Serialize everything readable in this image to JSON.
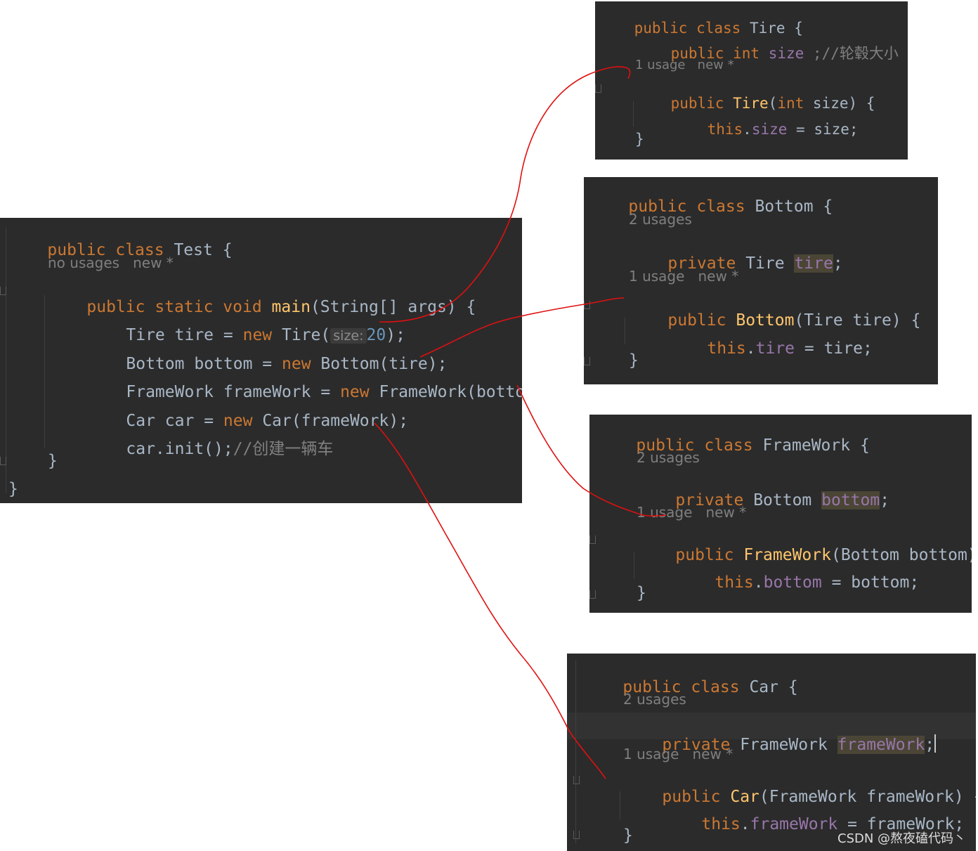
{
  "test": {
    "l1": {
      "kw1": "public",
      "kw2": "class",
      "name": "Test",
      "brace": "{"
    },
    "hint": "no usages   new *",
    "l2": {
      "kw1": "public",
      "kw2": "static",
      "kw3": "void",
      "method": "main",
      "rest": "(String[] args) {"
    },
    "l3": {
      "type": "Tire",
      "var": "tire",
      "eq": "=",
      "kw": "new",
      "ctor": "Tire(",
      "param_hint": "size:",
      "num": "20",
      "end": ");"
    },
    "l4": {
      "type": "Bottom",
      "var": "bottom",
      "eq": "=",
      "kw": "new",
      "rest": "Bottom(tire);"
    },
    "l5": {
      "type": "FrameWork",
      "var": "frameWork",
      "eq": "=",
      "kw": "new",
      "rest": "FrameWork(bottom);"
    },
    "l6": {
      "type": "Car",
      "var": "car",
      "eq": "=",
      "kw": "new",
      "rest": "Car(frameWork);"
    },
    "l7": {
      "code": "car.init();",
      "comment": "//创建一辆车"
    },
    "close_inner": "}",
    "close_outer": "}"
  },
  "tire": {
    "l1": {
      "kw1": "public",
      "kw2": "class",
      "name": "Tire",
      "brace": "{"
    },
    "l2": {
      "kw1": "public",
      "kw2": "int",
      "field": "size",
      "comment": ";//轮毂大小"
    },
    "hint": "1 usage   new *",
    "l3": {
      "kw": "public",
      "ctor": "Tire",
      "p1": "(",
      "ptype": "int",
      "rest": " size) {"
    },
    "l4": {
      "kw": "this",
      "dot": ".",
      "field": "size",
      "rest": " = size;"
    },
    "close": "}"
  },
  "bottom": {
    "l1": {
      "kw1": "public",
      "kw2": "class",
      "name": "Bottom",
      "brace": "{"
    },
    "hint1": "2 usages",
    "l2": {
      "kw": "private",
      "type": "Tire",
      "field": "tire",
      "semi": ";"
    },
    "hint2": "1 usage   new *",
    "l3": {
      "kw": "public",
      "ctor": "Bottom",
      "rest": "(Tire tire) {"
    },
    "l4": {
      "kw": "this",
      "dot": ".",
      "field": "tire",
      "rest": " = tire;"
    },
    "close": "}"
  },
  "framework": {
    "l1": {
      "kw1": "public",
      "kw2": "class",
      "name": "FrameWork",
      "brace": "{"
    },
    "hint1": "2 usages",
    "l2": {
      "kw": "private",
      "type": "Bottom",
      "field": "bottom",
      "semi": ";"
    },
    "hint2": "1 usage   new *",
    "l3": {
      "kw": "public",
      "ctor": "FrameWork",
      "rest": "(Bottom bottom) {"
    },
    "l4": {
      "kw": "this",
      "dot": ".",
      "field": "bottom",
      "rest": " = bottom;"
    },
    "close": "}"
  },
  "car": {
    "l1": {
      "kw1": "public",
      "kw2": "class",
      "name": "Car",
      "brace": "{"
    },
    "hint1": "2 usages",
    "l2": {
      "kw": "private",
      "type": "FrameWork",
      "field": "frameWork",
      "semi": ";"
    },
    "hint2": "1 usage   new *",
    "l3": {
      "kw": "public",
      "ctor": "Car",
      "rest": "(FrameWork frameWork) {"
    },
    "l4": {
      "kw": "this",
      "dot": ".",
      "field": "frameWork",
      "rest": " = frameWork;"
    },
    "close": "}"
  },
  "watermark": "CSDN @熬夜磕代码丶",
  "colors": {
    "bg": "#2b2b2b",
    "keyword": "#cc7832",
    "method": "#ffc66d",
    "field": "#9876aa",
    "text": "#a9b7c6",
    "number": "#6897bb",
    "comment": "#808080",
    "arrow": "#e01010"
  }
}
